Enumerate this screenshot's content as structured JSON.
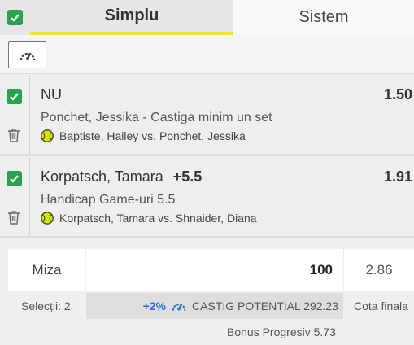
{
  "tabs": {
    "all_checked": true,
    "simplu": "Simplu",
    "sistem": "Sistem"
  },
  "toolbar": {
    "speed_icon": "speedometer-icon"
  },
  "bets": [
    {
      "checked": true,
      "pick": "NU",
      "handicap": "",
      "odds": "1.50",
      "market": "Ponchet, Jessika - Castiga minim un set",
      "event": "Baptiste, Hailey vs. Ponchet, Jessika",
      "sport_icon": "tennis-ball-icon"
    },
    {
      "checked": true,
      "pick": "Korpatsch, Tamara",
      "handicap": "+5.5",
      "odds": "1.91",
      "market": "Handicap Game-uri 5.5",
      "event": "Korpatsch, Tamara vs. Shnaider, Diana",
      "sport_icon": "tennis-ball-icon"
    }
  ],
  "stake": {
    "label": "Miza",
    "value": "100",
    "total_odds": "2.86"
  },
  "summary": {
    "selections": "Selecții: 2",
    "boost": "+2%",
    "potential": "CASTIG POTENTIAL 292.23",
    "odds_label": "Cota finala",
    "bonus": "Bonus Progresiv 5.73"
  },
  "colors": {
    "check_green": "#26a34d",
    "tab_accent": "#f5ea00",
    "boost_blue": "#2a6fd6",
    "tennis_ball": "#d6e600"
  }
}
